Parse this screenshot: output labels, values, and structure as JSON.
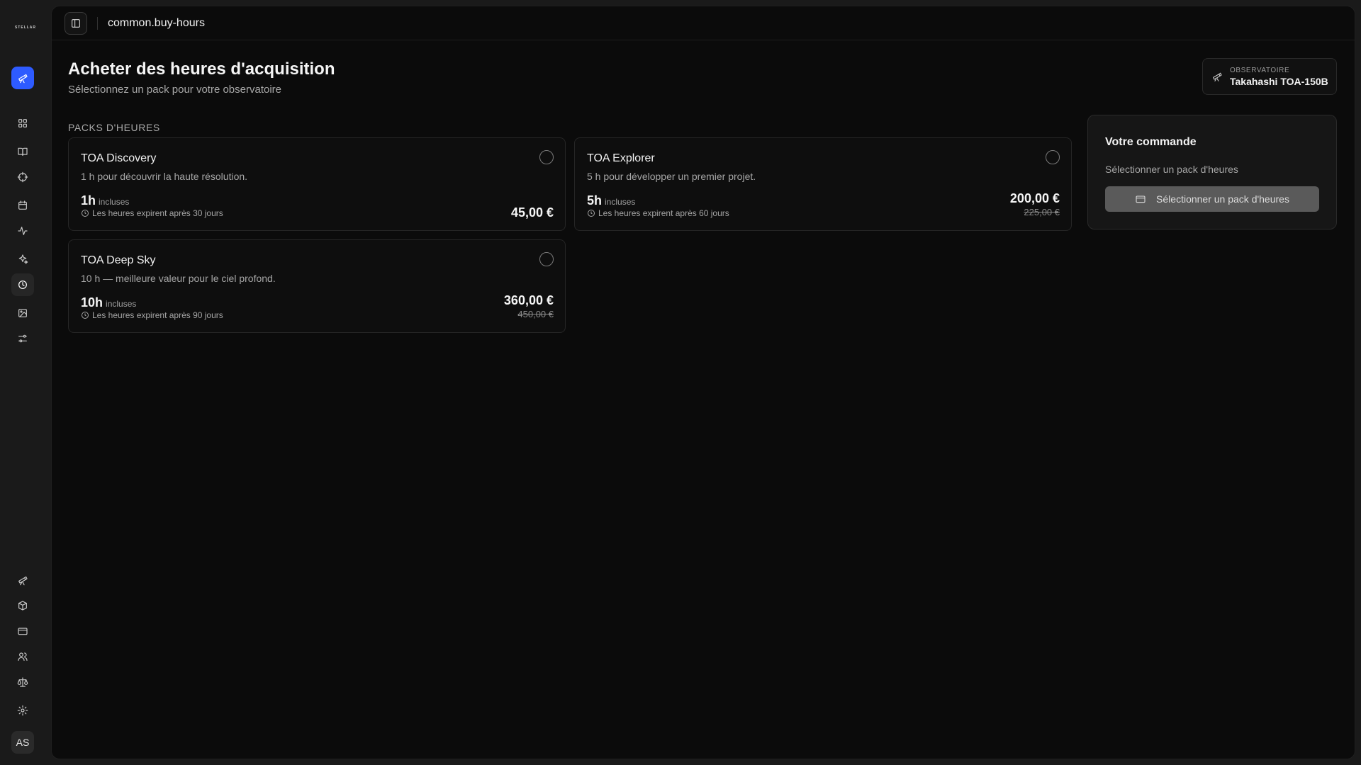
{
  "brand": {
    "logo_text": "STELLAR"
  },
  "topbar": {
    "breadcrumb": "common.buy-hours"
  },
  "header": {
    "title": "Acheter des heures d'acquisition",
    "subtitle": "Sélectionnez un pack pour votre observatoire"
  },
  "observatory": {
    "label": "OBSERVATOIRE",
    "name": "Takahashi TOA-150B"
  },
  "packs_section": {
    "label": "PACKS D'HEURES"
  },
  "packs": [
    {
      "name": "TOA Discovery",
      "description": "1 h pour découvrir la haute résolution.",
      "hours": "1h",
      "included": "incluses",
      "expiry": "Les heures expirent après 30 jours",
      "price": "45,00 €",
      "old_price": ""
    },
    {
      "name": "TOA Explorer",
      "description": "5 h pour développer un premier projet.",
      "hours": "5h",
      "included": "incluses",
      "expiry": "Les heures expirent après 60 jours",
      "price": "200,00 €",
      "old_price": "225,00 €"
    },
    {
      "name": "TOA Deep Sky",
      "description": "10 h — meilleure valeur pour le ciel profond.",
      "hours": "10h",
      "included": "incluses",
      "expiry": "Les heures expirent après 90 jours",
      "price": "360,00 €",
      "old_price": "450,00 €"
    }
  ],
  "order": {
    "title": "Votre commande",
    "hint": "Sélectionner un pack d'heures",
    "button_label": "Sélectionner un pack d'heures"
  },
  "user": {
    "initials": "AS"
  },
  "colors": {
    "accent": "#2e5bff",
    "background": "#0b0b0b",
    "sidebar": "#1a1a1a"
  }
}
